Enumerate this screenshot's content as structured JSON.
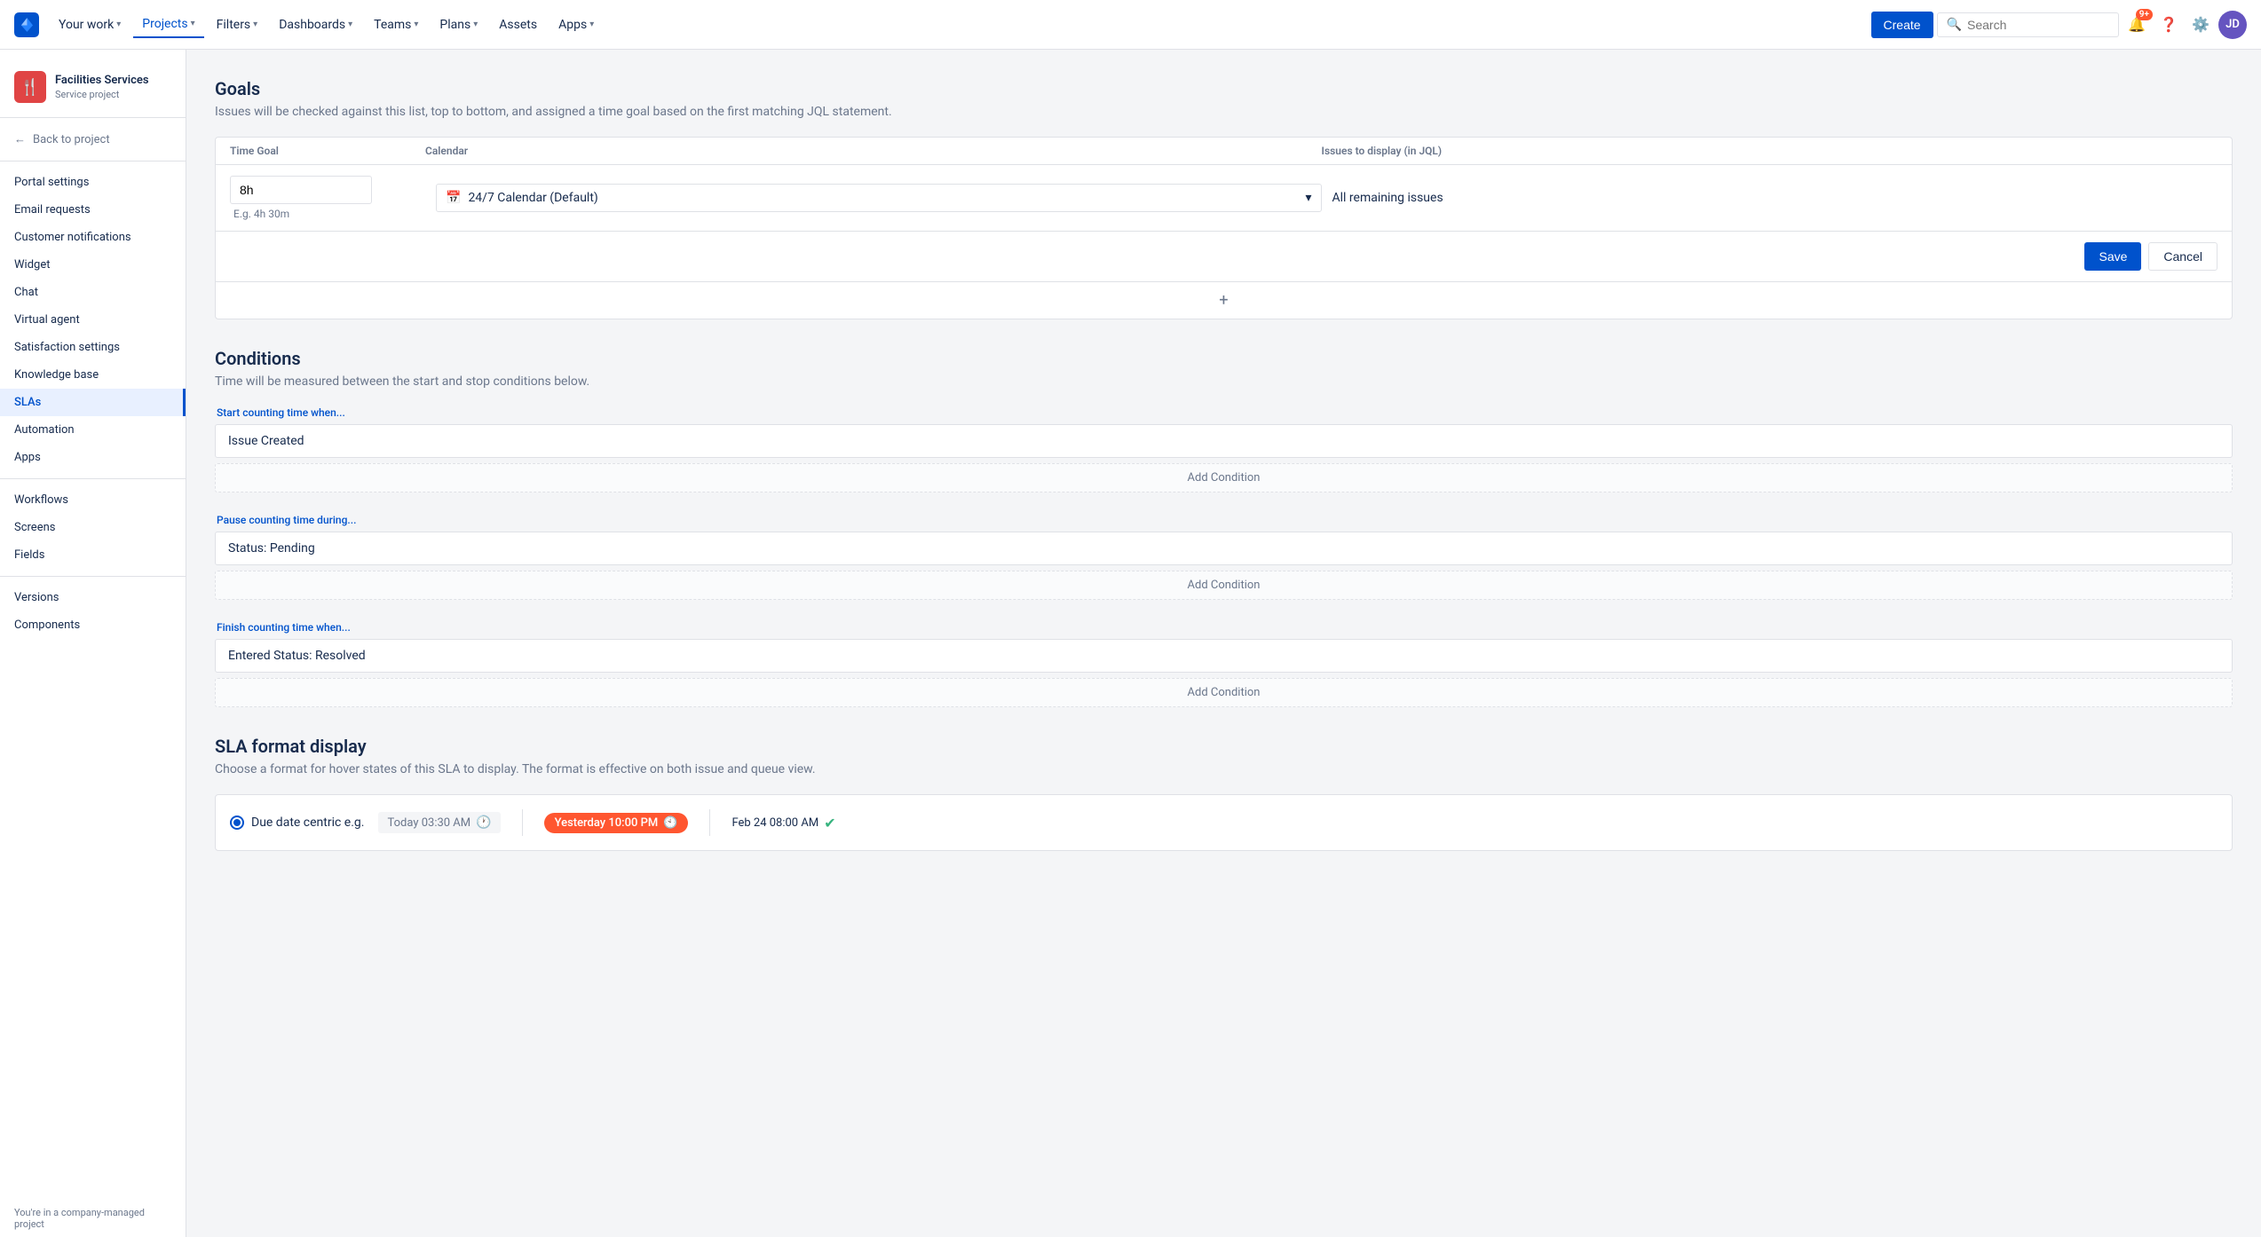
{
  "topnav": {
    "logo_text": "Jira",
    "items": [
      {
        "label": "Your work",
        "has_dropdown": true,
        "active": false
      },
      {
        "label": "Projects",
        "has_dropdown": true,
        "active": true
      },
      {
        "label": "Filters",
        "has_dropdown": true,
        "active": false
      },
      {
        "label": "Dashboards",
        "has_dropdown": true,
        "active": false
      },
      {
        "label": "Teams",
        "has_dropdown": true,
        "active": false
      },
      {
        "label": "Plans",
        "has_dropdown": true,
        "active": false
      },
      {
        "label": "Assets",
        "has_dropdown": false,
        "active": false
      },
      {
        "label": "Apps",
        "has_dropdown": true,
        "active": false
      }
    ],
    "create_label": "Create",
    "search_placeholder": "Search",
    "notification_badge": "9+",
    "avatar_initials": "JD"
  },
  "sidebar": {
    "project_name": "Facilities Services",
    "project_type": "Service project",
    "back_label": "Back to project",
    "nav_items": [
      {
        "label": "Portal settings",
        "active": false
      },
      {
        "label": "Email requests",
        "active": false
      },
      {
        "label": "Customer notifications",
        "active": false
      },
      {
        "label": "Widget",
        "active": false
      },
      {
        "label": "Chat",
        "active": false
      },
      {
        "label": "Virtual agent",
        "active": false
      },
      {
        "label": "Satisfaction settings",
        "active": false
      },
      {
        "label": "Knowledge base",
        "active": false
      },
      {
        "label": "SLAs",
        "active": true
      },
      {
        "label": "Automation",
        "active": false
      },
      {
        "label": "Apps",
        "active": false
      },
      {
        "label": "Workflows",
        "active": false
      },
      {
        "label": "Screens",
        "active": false
      },
      {
        "label": "Fields",
        "active": false
      },
      {
        "label": "Versions",
        "active": false
      },
      {
        "label": "Components",
        "active": false
      }
    ],
    "footer_text": "You're in a company-managed project"
  },
  "main": {
    "goals_section": {
      "title": "Goals",
      "description": "Issues will be checked against this list, top to bottom, and assigned a time goal based on the first matching JQL statement.",
      "table_headers": {
        "time_goal": "Time Goal",
        "calendar": "Calendar",
        "issues": "Issues to display (in JQL)"
      },
      "row": {
        "time_value": "8h",
        "time_hint": "E.g. 4h 30m",
        "calendar_value": "24/7 Calendar (Default)",
        "issues_value": "All remaining issues"
      },
      "save_label": "Save",
      "cancel_label": "Cancel",
      "add_symbol": "+"
    },
    "conditions_section": {
      "title": "Conditions",
      "description": "Time will be measured between the start and stop conditions below.",
      "start_label": "Start counting time when...",
      "start_condition": "Issue Created",
      "start_add_label": "Add Condition",
      "pause_label": "Pause counting time during...",
      "pause_condition": "Status: Pending",
      "pause_add_label": "Add Condition",
      "finish_label": "Finish counting time when...",
      "finish_condition": "Entered Status: Resolved",
      "finish_add_label": "Add Condition"
    },
    "sla_format_section": {
      "title": "SLA format display",
      "description": "Choose a format for hover states of this SLA to display. The format is effective on both issue and queue view.",
      "option_due_label": "Due date centric e.g.",
      "example_today": "Today 03:30 AM",
      "example_overdue": "Yesterday 10:00 PM",
      "example_future": "Feb 24 08:00 AM"
    }
  }
}
